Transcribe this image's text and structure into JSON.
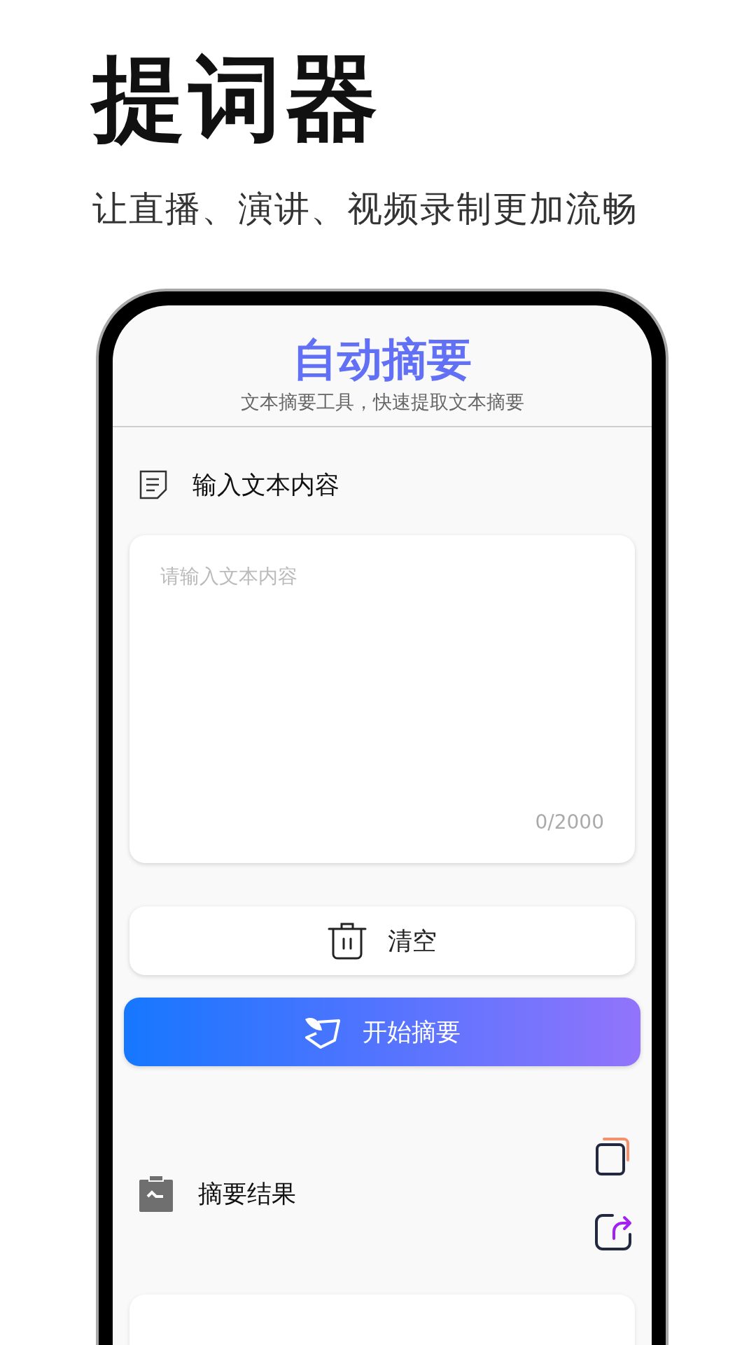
{
  "headline": "提词器",
  "tagline": "让直播、演讲、视频录制更加流畅",
  "app": {
    "title": "自动摘要",
    "subtitle": "文本摘要工具，快速提取文本摘要",
    "input_section": {
      "label": "输入文本内容",
      "placeholder": "请输入文本内容",
      "counter": "0/2000"
    },
    "clear_button": "清空",
    "start_button": "开始摘要",
    "result_section": {
      "label": "摘要结果"
    }
  }
}
